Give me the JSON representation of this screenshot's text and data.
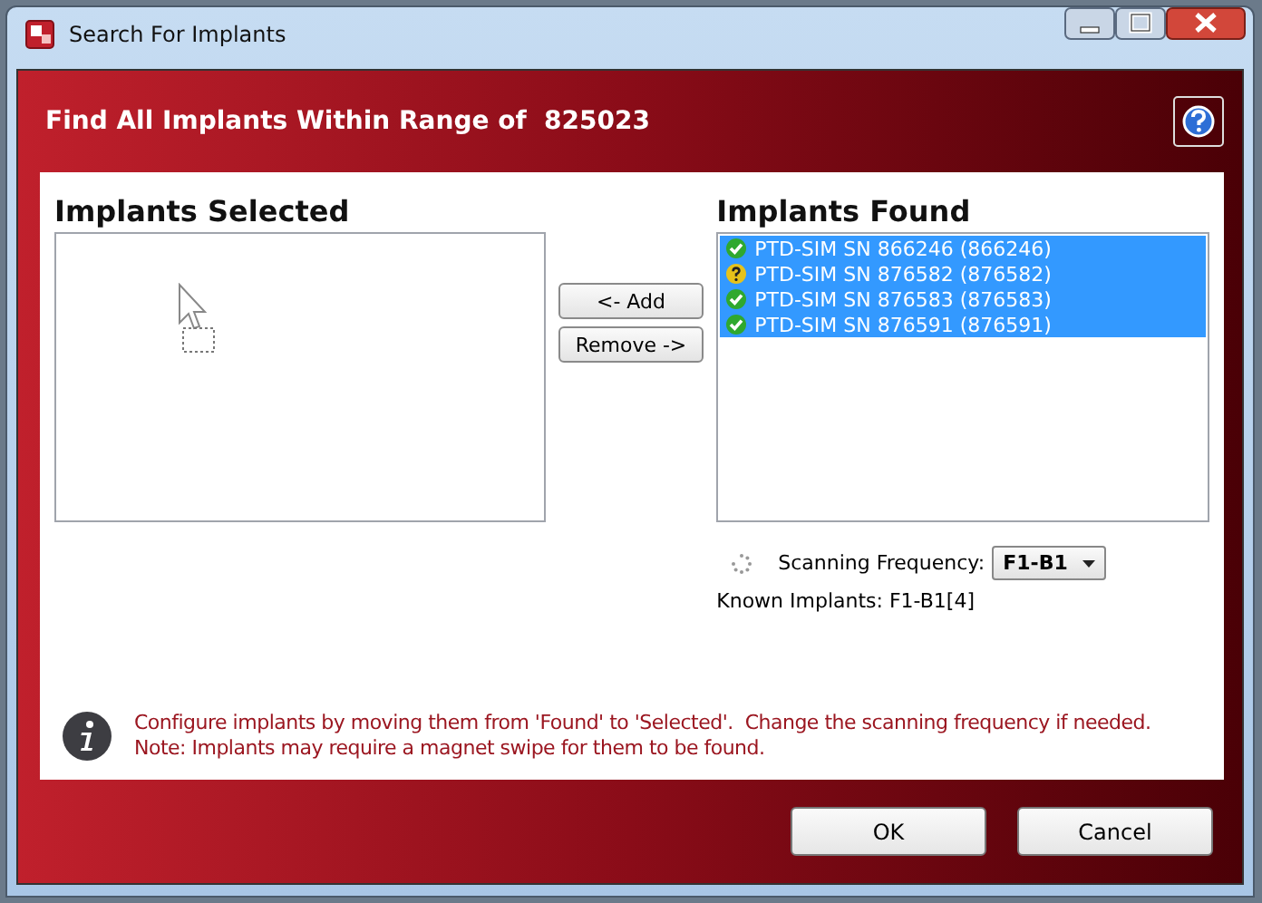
{
  "window": {
    "title": "Search For Implants"
  },
  "header": {
    "title": "Find All Implants Within Range of  825023"
  },
  "selected_list": {
    "label": "Implants Selected"
  },
  "move_buttons": [
    "<- Add",
    "Remove ->"
  ],
  "found_list": {
    "label": "Implants Found",
    "items": [
      {
        "text": "PTD-SIM SN 866246 (866246)",
        "kind": "ok",
        "selected": true
      },
      {
        "text": "PTD-SIM SN 876582 (876582)",
        "kind": "unknown",
        "selected": true
      },
      {
        "text": "PTD-SIM SN 876583 (876583)",
        "kind": "ok",
        "selected": true
      },
      {
        "text": "PTD-SIM SN 876591 (876591)",
        "kind": "ok",
        "selected": true
      }
    ]
  },
  "scanning": {
    "label": "Scanning Frequency:",
    "value": "F1-B1"
  },
  "known": "Known Implants: F1-B1[4]",
  "info": [
    "Configure implants by moving them from 'Found' to 'Selected'.  Change the scanning frequency if needed.",
    "Note: Implants may require a magnet swipe for them to be found."
  ],
  "buttons": [
    "OK",
    "Cancel"
  ]
}
